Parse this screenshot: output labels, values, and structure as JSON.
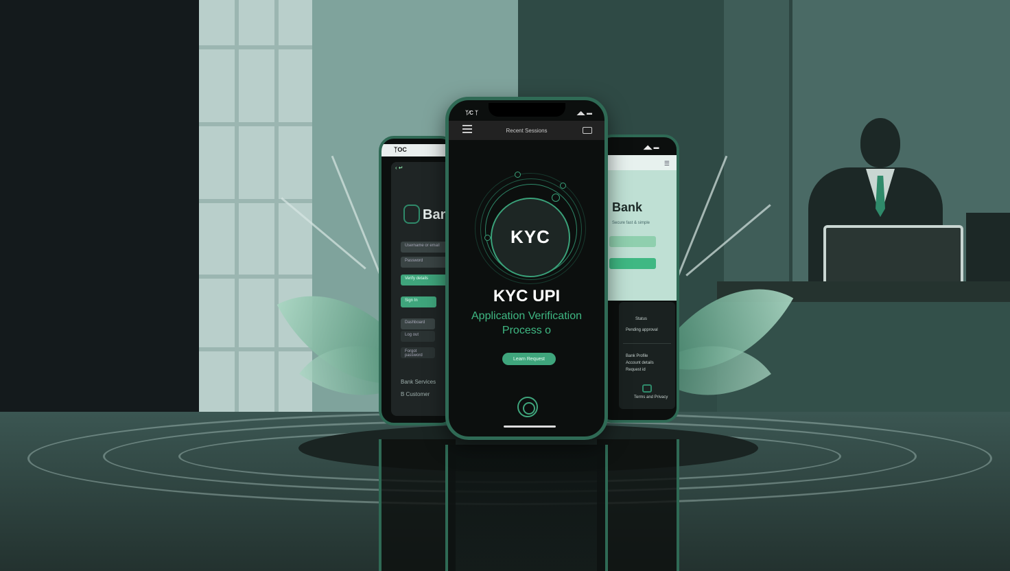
{
  "center_phone": {
    "status_time": "ᛉ⁄C ᛉ",
    "status_signal": "◢◣ ▬",
    "header_title": "Recent Sessions",
    "menu_icon": "hamburger-menu-icon",
    "card_icon": "card-icon",
    "badge_text": "KYC",
    "headline": "KYC UPI",
    "subtitle_line1": "Application Verification",
    "subtitle_line2": "Process o",
    "button_label": "Learn Request",
    "fingerprint_icon": "fingerprint-icon"
  },
  "left_phone": {
    "status_text": "ᛉOC",
    "back_text": "‹ ↵",
    "logo_icon": "bank-logo-icon",
    "brand": "Bank",
    "fields": [
      "Username or email",
      "Password",
      "Verify details"
    ],
    "button_label": "Sign In",
    "links": [
      "Dashboard",
      "Log out",
      "Forgot password",
      "Bank Services"
    ],
    "footer_links": [
      "B Customer"
    ]
  },
  "right_phone": {
    "status_text": "◢◣ ▬",
    "menu_icon": "menu-icon",
    "brand": "Bank",
    "subtitle": "Secure fast & simple",
    "card_lines": [
      "Status",
      "Pending approval",
      "Bank Profile",
      "Account details",
      "Request id"
    ],
    "card_icon": "bank-icon",
    "card_footer": "Terms and Privacy"
  },
  "colors": {
    "accent_green": "#3fa57c",
    "phone_frame": "#2f6a55",
    "dark_bg": "#141a1c"
  }
}
